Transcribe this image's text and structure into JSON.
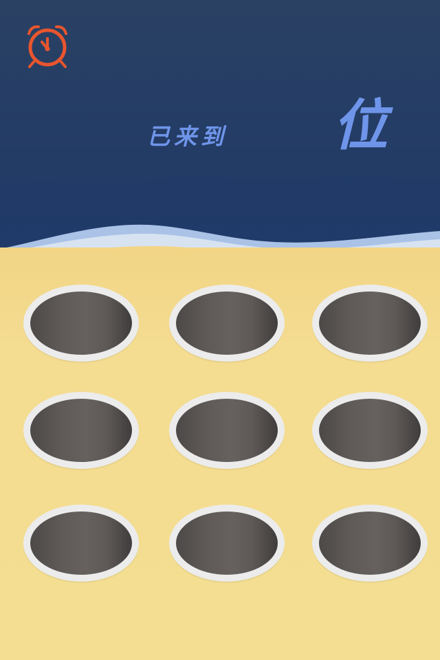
{
  "header": {
    "alarm_icon": "alarm-clock-icon",
    "status_label": "已来到",
    "count": "",
    "unit_label": "位"
  },
  "colors": {
    "sea_dark": "#233c66",
    "sea_light": "#2e4670",
    "shore_foam": "#d7e3f1",
    "shore_blue": "#a9c2e6",
    "sand": "#f3de91",
    "text_accent": "#6f95ea",
    "alarm": "#e8552e",
    "hole_rim": "#ececec",
    "hole_dark": "#5c5856"
  },
  "board": {
    "rows": 3,
    "columns": 3,
    "holes": [
      {
        "row": 1,
        "col": 1
      },
      {
        "row": 1,
        "col": 2
      },
      {
        "row": 1,
        "col": 3
      },
      {
        "row": 2,
        "col": 1
      },
      {
        "row": 2,
        "col": 2
      },
      {
        "row": 2,
        "col": 3
      },
      {
        "row": 3,
        "col": 1
      },
      {
        "row": 3,
        "col": 2
      },
      {
        "row": 3,
        "col": 3
      }
    ]
  }
}
